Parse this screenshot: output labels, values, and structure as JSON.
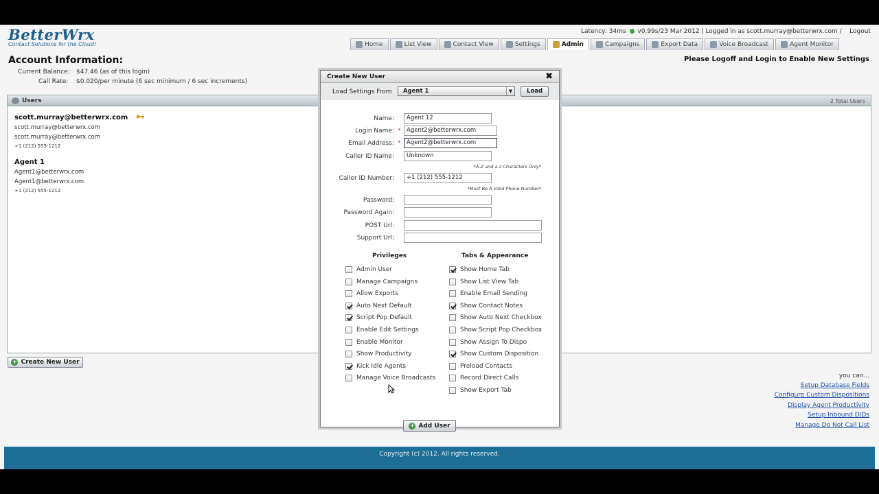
{
  "logo": {
    "main": "BetterWrx",
    "sub": "Contact Solutions for the Cloud!"
  },
  "header": {
    "latency": "Latency: 34ms",
    "version": "v0.99s/23 Mar 2012",
    "logged_in": "Logged in as scott.murray@betterwrx.com",
    "separator": "/",
    "logout": "Logout",
    "status_color": "#3aa043"
  },
  "tabs": [
    "Home",
    "List View",
    "Contact View",
    "Settings",
    "Admin",
    "Campaigns",
    "Export Data",
    "Voice Broadcast",
    "Agent Monitor"
  ],
  "account": {
    "title": "Account Information:",
    "balance_label": "Current Balance:",
    "balance_value": "$47.46 (as of this login)",
    "rate_label": "Call Rate:",
    "rate_value": "$0.020/per minute (6 sec minimum / 6 sec increments)"
  },
  "notice": "Please Logoff and Login to Enable New Settings",
  "users_panel": {
    "title": "Users",
    "count": "2 Total Users",
    "users": [
      {
        "name": "scott.murray@betterwrx.com",
        "login": "scott.murray@betterwrx.com",
        "email": "scott.murray@betterwrx.com",
        "phone": "+1 (212) 555-1212"
      },
      {
        "name": "Agent 1",
        "login": "Agent1@betterwrx.com",
        "email": "Agent1@betterwrx.com",
        "phone": "+1 (212) 555-1212"
      }
    ]
  },
  "create_button": "Create New User",
  "sidebar": {
    "you_can": "you can...",
    "links": [
      "Setup Database Fields",
      "Configure Custom Dispositions",
      "Display Agent Productivity",
      "Setup Inbound DIDs",
      "Manage Do Not Call List"
    ]
  },
  "footer": "Copyright (c) 2012. All rights reserved.",
  "modal": {
    "title": "Create New User",
    "close": "✖",
    "load_label": "Load Settings From",
    "load_selected": "Agent 1",
    "load_button": "Load",
    "fields": {
      "name_label": "Name:",
      "name_value": "Agent 12",
      "login_label": "Login Name:",
      "login_value": "Agent2@betterwrx.com",
      "email_label": "Email Address:",
      "email_value": "Agent2@betterwrx.com",
      "callerid_name_label": "Caller ID Name:",
      "callerid_name_value": "Unknown",
      "callerid_name_hint": "*A-Z and a-z Characters Only*",
      "callerid_number_label": "Caller ID Number:",
      "callerid_number_value": "+1 (212) 555-1212",
      "callerid_number_hint": "*Must Be A Valid Phone Number*",
      "password_label": "Password:",
      "password2_label": "Password Again:",
      "post_label": "POST Url:",
      "support_label": "Support Url:",
      "required_mark": "*"
    },
    "privileges_title": "Privileges",
    "privileges": [
      {
        "label": "Admin User",
        "checked": false
      },
      {
        "label": "Manage Campaigns",
        "checked": false
      },
      {
        "label": "Allow Exports",
        "checked": false
      },
      {
        "label": "Auto Next Default",
        "checked": true
      },
      {
        "label": "Script Pop Default",
        "checked": true
      },
      {
        "label": "Enable Edit Settings",
        "checked": false
      },
      {
        "label": "Enable Monitor",
        "checked": false
      },
      {
        "label": "Show Productivity",
        "checked": false
      },
      {
        "label": "Kick Idle Agents",
        "checked": true
      },
      {
        "label": "Manage Voice Broadcasts",
        "checked": false
      }
    ],
    "tabs_title": "Tabs & Appearance",
    "appearance": [
      {
        "label": "Show Home Tab",
        "checked": true
      },
      {
        "label": "Show List View Tab",
        "checked": false
      },
      {
        "label": "Enable Email Sending",
        "checked": false
      },
      {
        "label": "Show Contact Notes",
        "checked": true
      },
      {
        "label": "Show Auto Next Checkbox",
        "checked": false
      },
      {
        "label": "Show Script Pop Checkbox",
        "checked": false
      },
      {
        "label": "Show Assign To Dispo",
        "checked": false
      },
      {
        "label": "Show Custom Disposition",
        "checked": true
      },
      {
        "label": "Preload Contacts",
        "checked": false
      },
      {
        "label": "Record Direct Calls",
        "checked": false
      },
      {
        "label": "Show Export Tab",
        "checked": false
      }
    ],
    "add_button": "Add User"
  }
}
